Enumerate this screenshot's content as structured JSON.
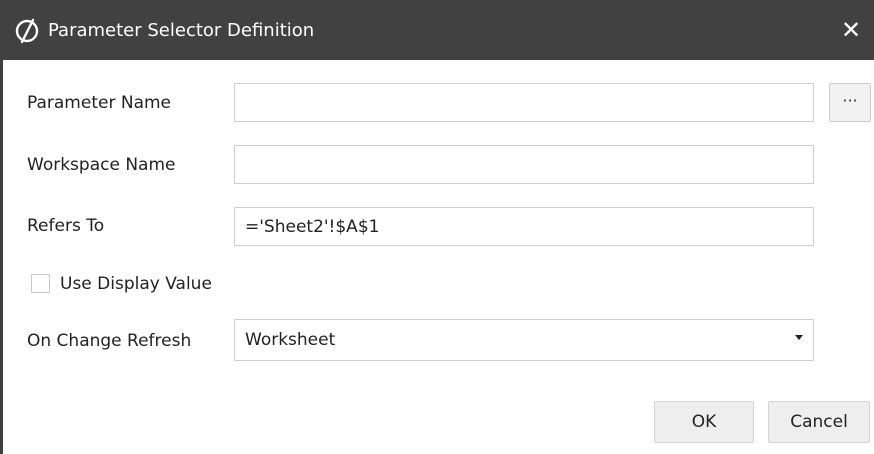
{
  "window": {
    "title": "Parameter Selector Definition",
    "close_symbol": "✕",
    "logo_icon": "app-logo-icon"
  },
  "form": {
    "parameter_name": {
      "label": "Parameter Name",
      "value": "",
      "browse_label": "···"
    },
    "workspace_name": {
      "label": "Workspace Name",
      "value": ""
    },
    "refers_to": {
      "label": "Refers To",
      "value": "='Sheet2'!$A$1"
    },
    "use_display_value": {
      "label": "Use Display Value",
      "checked": false
    },
    "on_change_refresh": {
      "label": "On Change Refresh",
      "selected": "Worksheet"
    }
  },
  "buttons": {
    "ok": "OK",
    "cancel": "Cancel"
  },
  "colors": {
    "titlebar": "#414141",
    "button_bg": "#eeeeee",
    "input_border": "#cfcfcf"
  }
}
